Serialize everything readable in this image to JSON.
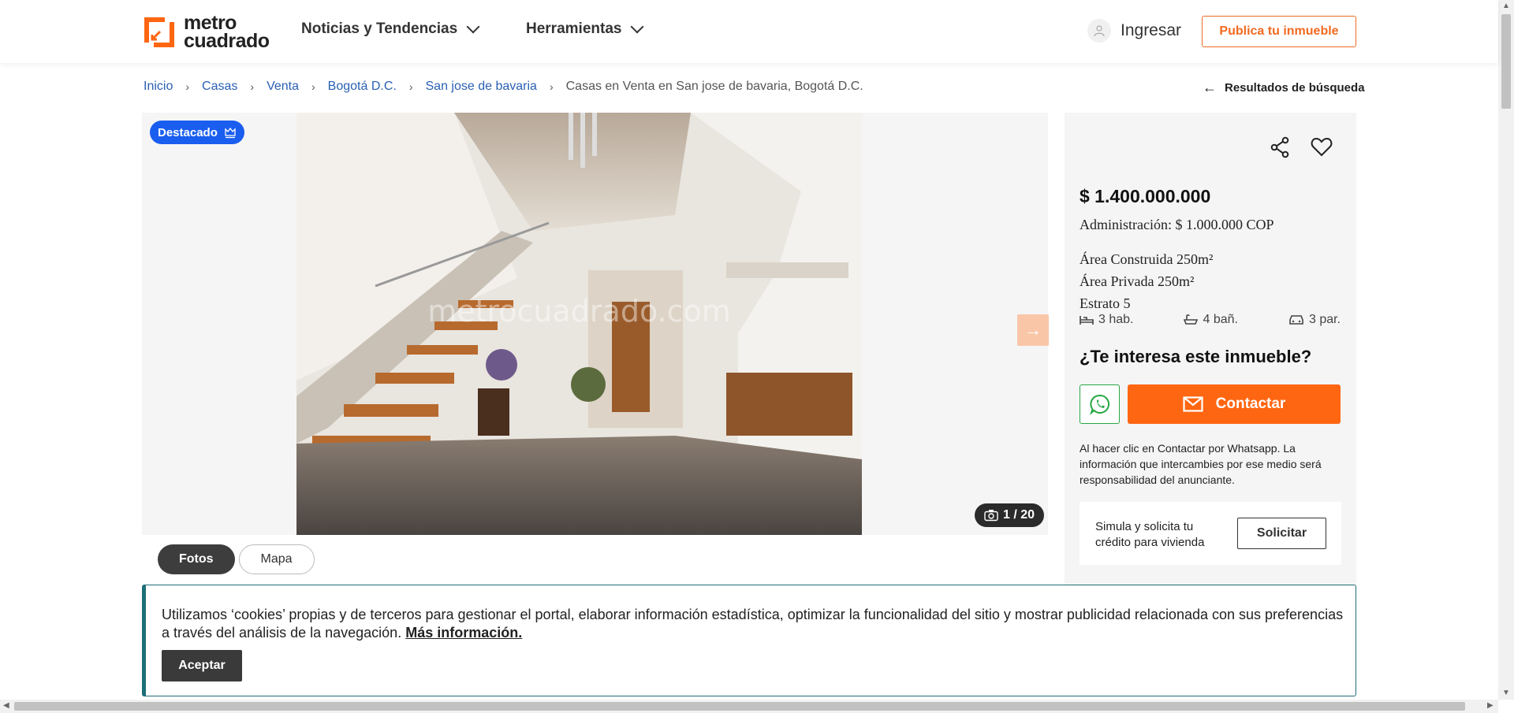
{
  "header": {
    "logo_line1": "metro",
    "logo_line2": "cuadrado",
    "nav": [
      {
        "label": "Noticias y Tendencias"
      },
      {
        "label": "Herramientas"
      }
    ],
    "login_label": "Ingresar",
    "publish_label": "Publica tu inmueble"
  },
  "breadcrumb": {
    "items": [
      "Inicio",
      "Casas",
      "Venta",
      "Bogotá D.C.",
      "San jose de bavaria"
    ],
    "current": "Casas en Venta en San jose de bavaria, Bogotá D.C.",
    "back_label": "Resultados de búsqueda"
  },
  "gallery": {
    "badge": "Destacado",
    "watermark": "metrocuadrado.com",
    "counter": "1 / 20",
    "tabs": [
      "Fotos",
      "Mapa"
    ]
  },
  "listing": {
    "price": "$ 1.400.000.000",
    "admin": "Administración: $ 1.000.000 COP",
    "area_built": "Área Construida 250m²",
    "area_private": "Área Privada 250m²",
    "estrato": "Estrato 5",
    "rooms": "3 hab.",
    "baths": "4 bañ.",
    "parking": "3 par.",
    "interest_title": "¿Te interesa este inmueble?",
    "contact_label": "Contactar",
    "disclaimer": "Al hacer clic en Contactar por Whatsapp. La información que intercambies por ese medio será responsabilidad del anunciante.",
    "credit_text": "Simula y solicita tu crédito para vivienda",
    "credit_button": "Solicitar"
  },
  "cookie": {
    "text": "Utilizamos ‘cookies’ propias y de terceros para gestionar el portal, elaborar información estadística, optimizar la funcionalidad del sitio y mostrar publicidad relacionada con sus preferencias a través del análisis de la navegación.",
    "more": "Más información.",
    "accept": "Aceptar"
  },
  "colors": {
    "brand_orange": "#ff6611",
    "link_blue": "#2a5fb4",
    "badge_blue": "#1a5ef0",
    "whatsapp_green": "#28a745",
    "cookie_teal": "#1e6e77"
  }
}
